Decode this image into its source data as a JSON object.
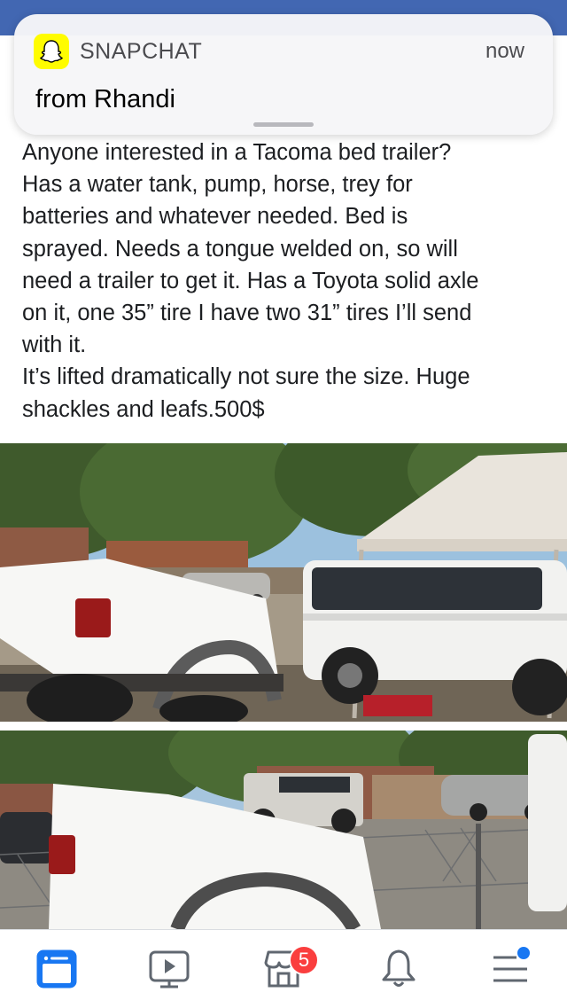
{
  "notification": {
    "app_name": "SNAPCHAT",
    "time": "now",
    "body": "from Rhandi",
    "app_color": "#fffc00"
  },
  "post": {
    "lines": [
      "Anyone interested in a Tacoma bed trailer?",
      "Has a water tank, pump, horse, trey for",
      "batteries and whatever needed. Bed is",
      "sprayed. Needs a tongue welded on, so will",
      "need a trailer to get it. Has a Toyota solid axle",
      "on it, one 35” tire I have two 31” tires I’ll send",
      "with it.",
      "It’s lifted dramatically not sure the size. Huge",
      "shackles and leafs.500$"
    ]
  },
  "photos": [
    {
      "subject": "white truck bed trailer next to white SUV under canopy"
    },
    {
      "subject": "white truck bed trailer next to chain link fence with parked cars"
    }
  ],
  "tab_bar": {
    "items": [
      {
        "icon": "news-feed-icon",
        "active": true
      },
      {
        "icon": "watch-video-icon",
        "active": false
      },
      {
        "icon": "marketplace-icon",
        "active": false,
        "badge": "5"
      },
      {
        "icon": "notifications-bell-icon",
        "active": false
      },
      {
        "icon": "menu-icon",
        "active": false
      }
    ],
    "active_color": "#1877f2",
    "inactive_color": "#606770",
    "badge_color": "#fa3e3e"
  },
  "header_color": "#4267b2"
}
